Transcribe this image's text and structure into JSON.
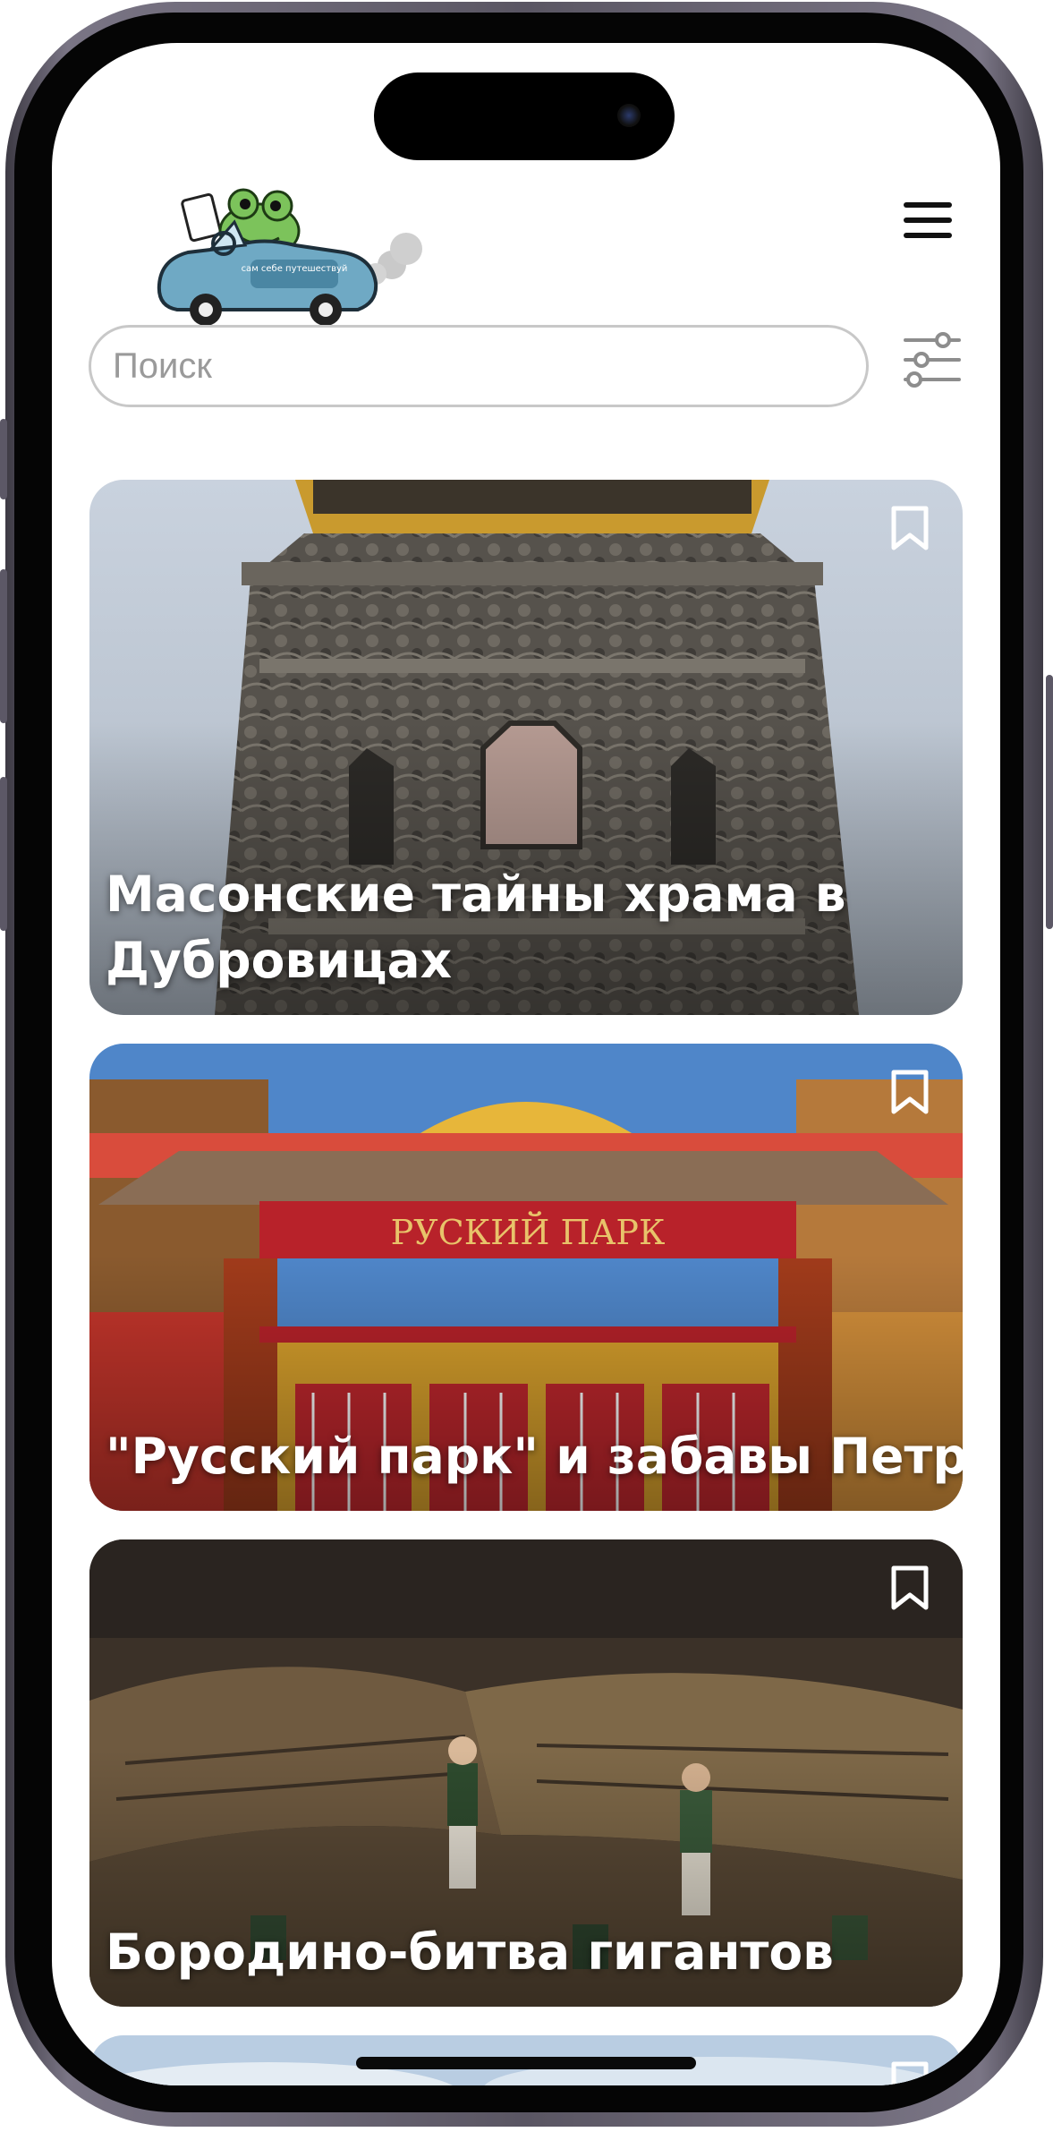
{
  "app": {
    "logo": {
      "icon": "frog-in-car-logo",
      "caption": "сам себе путешествуй"
    }
  },
  "header": {
    "menu_icon": "hamburger-menu-icon"
  },
  "search": {
    "placeholder": "Поиск",
    "value": "",
    "filter_icon": "filter-sliders-icon"
  },
  "colors": {
    "accent": "#6fa9c4",
    "frame": "#5a5663",
    "text_on_image": "#ffffff",
    "search_border": "#c8c8c8"
  },
  "cards": [
    {
      "title": "Масонские тайны храма в Дубровицах",
      "image": "dubrovitsy-church-tower",
      "bookmark_icon": "bookmark-icon"
    },
    {
      "title": "\"Русский парк\" и забавы Петра I",
      "image": "russian-park-gate",
      "bookmark_icon": "bookmark-icon"
    },
    {
      "title": "Бородино-битва гигантов",
      "image": "borodino-diorama",
      "bookmark_icon": "bookmark-icon"
    },
    {
      "title": "",
      "image": "sky-landscape",
      "bookmark_icon": "bookmark-icon"
    }
  ]
}
